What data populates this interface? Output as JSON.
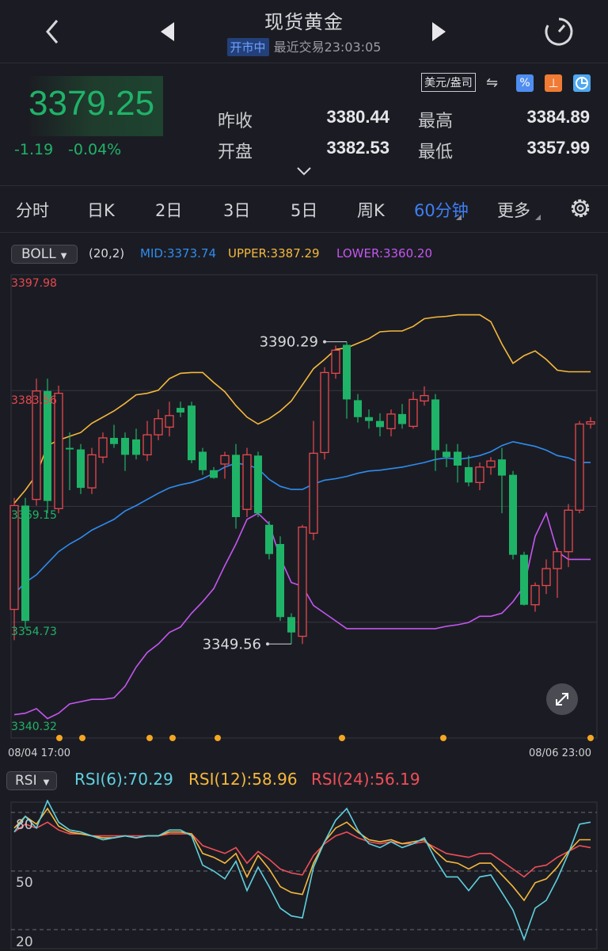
{
  "header": {
    "title": "现货黄金",
    "status_badge": "开市中",
    "last_trade": "最近交易23:03:05"
  },
  "quote": {
    "price": "3379.25",
    "change": "-1.19",
    "change_pct": "-0.04%",
    "prev_close_label": "昨收",
    "prev_close": "3380.44",
    "open_label": "开盘",
    "open": "3382.53",
    "high_label": "最高",
    "high": "3384.89",
    "low_label": "最低",
    "low": "3357.99",
    "currency_unit": "美元/盎司",
    "up_color": "#e8484f",
    "down_color": "#1fb368"
  },
  "tabs": [
    "分时",
    "日K",
    "2日",
    "3日",
    "5日",
    "周K",
    "60分钟",
    "更多"
  ],
  "active_tab": "60分钟",
  "boll": {
    "selector": "BOLL",
    "params": "(20,2)",
    "mid": "MID:3373.74",
    "upper": "UPPER:3387.29",
    "lower": "LOWER:3360.20",
    "mid_color": "#2e8cf0",
    "upper_color": "#f5b83d",
    "lower_color": "#c456f0"
  },
  "price_axis": {
    "labels": [
      "3397.98",
      "3383.56",
      "3369.15",
      "3354.73",
      "3340.32"
    ],
    "range": [
      3340.32,
      3397.98
    ],
    "high_marker": "3390.29",
    "low_marker": "3349.56"
  },
  "time_axis": {
    "start": "08/04 17:00",
    "end": "08/06 23:00"
  },
  "rsi": {
    "selector": "RSI",
    "rsi6": "RSI(6):70.29",
    "rsi12": "RSI(12):58.96",
    "rsi24": "RSI(24):56.19",
    "rsi6_color": "#5fd0e0",
    "rsi12_color": "#f5b83d",
    "rsi24_color": "#ef4e58",
    "axis_labels": [
      "80",
      "50",
      "20"
    ]
  },
  "chart_data": {
    "type": "candlestick",
    "candles": [
      [
        3355.5,
        3369.0,
        3351.5,
        3370.0
      ],
      [
        3369.0,
        3354.0,
        3353.0,
        3370.0
      ],
      [
        3369.8,
        3383.9,
        3369.0,
        3385.5
      ],
      [
        3383.9,
        3369.6,
        3368.0,
        3385.5
      ],
      [
        3368.6,
        3383.6,
        3368.0,
        3384.6
      ],
      [
        3376.5,
        3376.3,
        3371.0,
        3378.5
      ],
      [
        3376.3,
        3371.3,
        3370.5,
        3377.0
      ],
      [
        3371.3,
        3375.6,
        3370.5,
        3376.5
      ],
      [
        3375.3,
        3377.8,
        3374.5,
        3378.5
      ],
      [
        3377.8,
        3377.0,
        3376.5,
        3379.5
      ],
      [
        3377.8,
        3375.6,
        3373.5,
        3378.5
      ],
      [
        3377.6,
        3375.6,
        3375.0,
        3379.0
      ],
      [
        3375.6,
        3378.2,
        3374.8,
        3380.0
      ],
      [
        3378.2,
        3380.3,
        3377.5,
        3381.5
      ],
      [
        3379.2,
        3380.7,
        3378.0,
        3382.5
      ],
      [
        3381.7,
        3381.1,
        3380.5,
        3382.5
      ],
      [
        3382.0,
        3374.9,
        3374.5,
        3382.5
      ],
      [
        3376.0,
        3373.6,
        3373.0,
        3376.5
      ],
      [
        3373.6,
        3372.6,
        3372.5,
        3374.0
      ],
      [
        3374.4,
        3375.5,
        3372.5,
        3376.0
      ],
      [
        3375.6,
        3367.5,
        3366.0,
        3377.0
      ],
      [
        3368.5,
        3375.6,
        3367.5,
        3376.5
      ],
      [
        3375.5,
        3368.0,
        3367.5,
        3376.0
      ],
      [
        3366.5,
        3362.7,
        3362.0,
        3367.0
      ],
      [
        3364.0,
        3354.5,
        3354.0,
        3365.0
      ],
      [
        3354.5,
        3352.5,
        3351.0,
        3355.0
      ],
      [
        3352.0,
        3366.2,
        3351.0,
        3366.5
      ],
      [
        3365.4,
        3375.8,
        3364.5,
        3380.0
      ],
      [
        3375.9,
        3386.3,
        3375.0,
        3387.0
      ],
      [
        3386.2,
        3389.2,
        3385.5,
        3389.8
      ],
      [
        3389.9,
        3382.8,
        3380.3,
        3390.3
      ],
      [
        3382.7,
        3380.5,
        3379.8,
        3383.5
      ],
      [
        3380.5,
        3380.0,
        3379.0,
        3381.5
      ],
      [
        3380.0,
        3379.2,
        3378.0,
        3381.0
      ],
      [
        3379.0,
        3380.9,
        3378.0,
        3381.5
      ],
      [
        3380.9,
        3379.6,
        3379.0,
        3382.2
      ],
      [
        3379.3,
        3382.8,
        3379.0,
        3383.8
      ],
      [
        3382.6,
        3383.3,
        3382.0,
        3384.5
      ],
      [
        3382.8,
        3376.2,
        3373.5,
        3383.5
      ],
      [
        3376.0,
        3375.3,
        3374.0,
        3377.0
      ],
      [
        3376.0,
        3374.2,
        3372.0,
        3377.0
      ],
      [
        3374.0,
        3372.0,
        3371.5,
        3375.5
      ],
      [
        3372.0,
        3374.0,
        3371.0,
        3374.6
      ],
      [
        3374.0,
        3374.8,
        3373.0,
        3375.3
      ],
      [
        3375.0,
        3372.9,
        3368.0,
        3376.5
      ],
      [
        3373.0,
        3362.6,
        3362.0,
        3373.5
      ],
      [
        3362.6,
        3356.1,
        3356.0,
        3363.0
      ],
      [
        3356.1,
        3358.6,
        3355.2,
        3359.0
      ],
      [
        3358.6,
        3360.8,
        3357.5,
        3362.0
      ],
      [
        3360.8,
        3363.0,
        3357.0,
        3363.5
      ],
      [
        3363.0,
        3368.4,
        3361.0,
        3369.2
      ],
      [
        3368.4,
        3379.6,
        3368.0,
        3380.0
      ],
      [
        3379.6,
        3379.9,
        3379.0,
        3380.5
      ]
    ],
    "mid": [
      3357.5,
      3359.0,
      3360.0,
      3361.5,
      3363.0,
      3364.0,
      3364.8,
      3365.8,
      3366.5,
      3367.2,
      3368.3,
      3369.0,
      3369.8,
      3370.6,
      3371.3,
      3371.7,
      3372.0,
      3372.5,
      3373.2,
      3374.0,
      3374.5,
      3374.3,
      3373.8,
      3372.4,
      3371.5,
      3371.1,
      3371.1,
      3371.8,
      3372.3,
      3372.5,
      3372.8,
      3373.2,
      3373.5,
      3373.6,
      3373.8,
      3374.0,
      3374.3,
      3374.6,
      3375.0,
      3375.2,
      3375.0,
      3375.2,
      3375.5,
      3376.0,
      3376.8,
      3377.3,
      3377.0,
      3376.7,
      3376.2,
      3375.5,
      3375.2,
      3374.6,
      3374.6
    ],
    "upper": [
      3369.3,
      3371.0,
      3373.0,
      3376.8,
      3377.5,
      3378.0,
      3378.5,
      3379.7,
      3380.5,
      3381.3,
      3382.3,
      3383.4,
      3383.6,
      3384.0,
      3385.5,
      3386.2,
      3386.3,
      3386.3,
      3385.0,
      3383.8,
      3382.0,
      3380.5,
      3379.6,
      3380.3,
      3381.3,
      3382.6,
      3384.7,
      3386.8,
      3388.0,
      3389.3,
      3389.5,
      3390.1,
      3390.7,
      3391.6,
      3391.7,
      3391.7,
      3392.3,
      3393.3,
      3393.5,
      3393.6,
      3393.8,
      3393.8,
      3393.8,
      3392.9,
      3390.0,
      3387.5,
      3388.5,
      3389.1,
      3388.0,
      3386.6,
      3386.4,
      3386.4,
      3386.4
    ],
    "lower": [
      3341.8,
      3342.0,
      3342.6,
      3341.3,
      3342.0,
      3343.2,
      3343.5,
      3343.8,
      3343.8,
      3344.0,
      3345.5,
      3348.0,
      3349.9,
      3351.0,
      3352.5,
      3353.2,
      3355.0,
      3356.5,
      3358.2,
      3361.2,
      3364.0,
      3367.2,
      3368.0,
      3366.6,
      3362.2,
      3359.0,
      3358.5,
      3356.0,
      3355.0,
      3354.0,
      3353.0,
      3353.0,
      3353.0,
      3353.0,
      3353.0,
      3353.0,
      3353.0,
      3353.0,
      3353.0,
      3353.3,
      3353.5,
      3353.8,
      3354.6,
      3354.6,
      3355.0,
      3356.5,
      3358.5,
      3365.0,
      3368.0,
      3363.0,
      3362.0,
      3362.0,
      3362.0
    ],
    "rsi6": [
      70,
      78,
      72,
      86,
      75,
      71,
      70,
      68,
      66,
      67,
      68,
      67,
      68,
      68,
      71,
      71,
      68,
      53,
      50,
      46,
      55,
      40,
      52,
      42,
      31,
      27,
      26,
      52,
      65,
      76,
      82,
      71,
      64,
      62,
      65,
      62,
      64,
      67,
      56,
      47,
      47,
      40,
      47,
      48,
      39,
      30,
      15,
      31,
      35,
      46,
      59,
      74,
      75
    ],
    "rsi12": [
      72,
      78,
      74,
      82,
      73,
      70,
      69,
      68,
      67,
      67,
      68,
      67,
      68,
      68,
      70,
      70,
      69,
      59,
      57,
      54,
      59,
      47,
      58,
      51,
      42,
      39,
      38,
      54,
      65,
      72,
      75,
      70,
      66,
      65,
      66,
      64,
      65,
      66,
      60,
      55,
      54,
      51,
      54,
      54,
      48,
      42,
      35,
      44,
      46,
      52,
      60,
      66,
      66
    ],
    "rsi24": [
      70,
      74,
      72,
      75,
      71,
      69,
      69,
      68,
      68,
      68,
      68,
      68,
      68,
      68,
      69,
      69,
      69,
      63,
      61,
      59,
      62,
      54,
      60,
      56,
      51,
      49,
      48,
      58,
      64,
      68,
      70,
      67,
      65,
      64,
      65,
      64,
      64,
      65,
      62,
      59,
      58,
      57,
      59,
      59,
      55,
      51,
      47,
      52,
      53,
      57,
      60,
      63,
      62
    ],
    "ylim": [
      3340.32,
      3397.98
    ],
    "rsi_ylim": [
      20,
      80
    ]
  }
}
